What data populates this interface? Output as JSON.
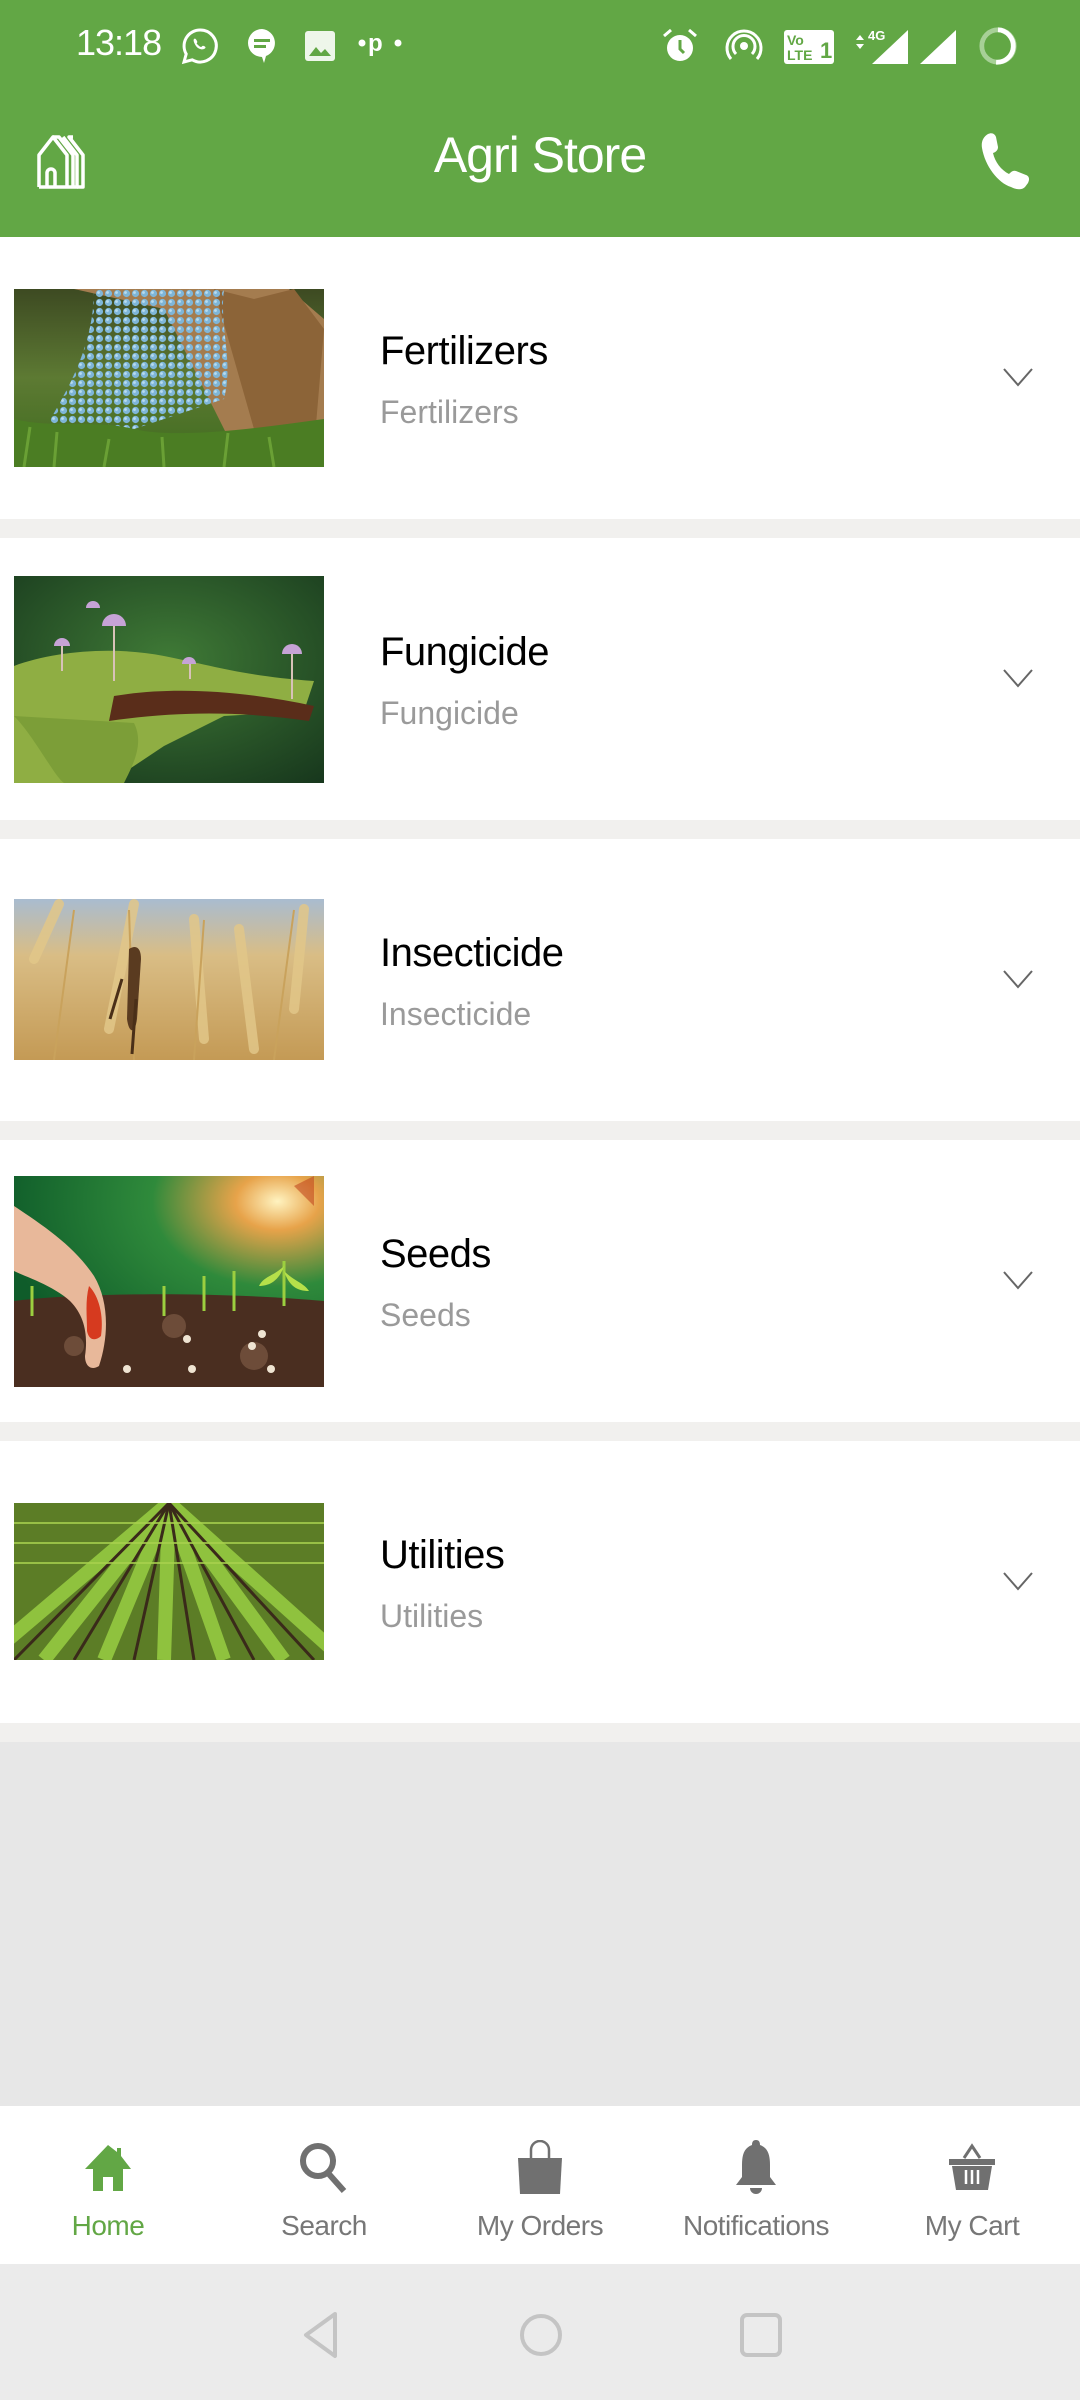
{
  "status_bar": {
    "time": "13:18",
    "left_icons": [
      "whatsapp-icon",
      "message-icon",
      "gallery-icon",
      "paytm-icon"
    ],
    "right_icons": [
      "alarm-icon",
      "hotspot-icon",
      "volte-icon",
      "signal-4g-icon",
      "signal-icon",
      "battery-icon"
    ],
    "network_label": "4G",
    "volte_label": "Vo LTE 1"
  },
  "header": {
    "title": "Agri Store",
    "left_icon": "store-home-icon",
    "right_icon": "phone-icon",
    "background_color": "#62A745"
  },
  "categories": [
    {
      "title": "Fertilizers",
      "subtitle": "Fertilizers",
      "image": "fertilizer-granules-image"
    },
    {
      "title": "Fungicide",
      "subtitle": "Fungicide",
      "image": "mushrooms-on-moss-image"
    },
    {
      "title": "Insecticide",
      "subtitle": "Insecticide",
      "image": "grasshopper-on-wheat-image"
    },
    {
      "title": "Seeds",
      "subtitle": "Seeds",
      "image": "hand-planting-seeds-image"
    },
    {
      "title": "Utilities",
      "subtitle": "Utilities",
      "image": "crop-rows-field-image"
    }
  ],
  "bottom_nav": {
    "active_color": "#62A745",
    "items": [
      {
        "label": "Home",
        "icon": "home-icon",
        "active": true
      },
      {
        "label": "Search",
        "icon": "search-icon",
        "active": false
      },
      {
        "label": "My Orders",
        "icon": "shopping-bag-icon",
        "active": false
      },
      {
        "label": "Notifications",
        "icon": "bell-icon",
        "active": false
      },
      {
        "label": "My Cart",
        "icon": "basket-icon",
        "active": false
      }
    ]
  },
  "system_nav": {
    "buttons": [
      "back-icon",
      "home-circle-icon",
      "recents-icon"
    ]
  }
}
